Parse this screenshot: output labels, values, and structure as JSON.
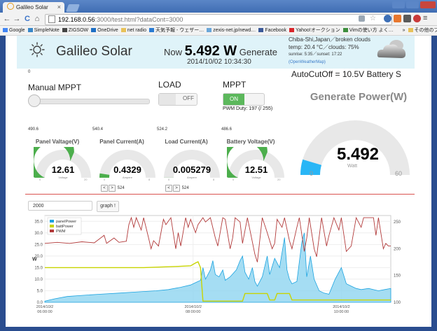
{
  "browser": {
    "tab_title": "Galileo Solar",
    "tab_close": "×",
    "url_host": "192.168.0.56",
    "url_rest": ":3000/test.html?dataCont=3000",
    "nav": {
      "back": "←",
      "forward": "→",
      "reload": "C",
      "home": "⌂"
    },
    "bookmarks": [
      {
        "label": "Google",
        "color": "#4285f4"
      },
      {
        "label": "SimpleNote",
        "color": "#3a87c8"
      },
      {
        "label": "ZIGSOW",
        "color": "#444444"
      },
      {
        "label": "OneDrive",
        "color": "#1e6fc4"
      },
      {
        "label": "net radio",
        "color": "#e8c25a"
      },
      {
        "label": "天気予報 - ウェザー…",
        "color": "#2a7bd3"
      },
      {
        "label": "zexis-net.jp/newd…",
        "color": "#6aa6d8"
      },
      {
        "label": "Facebook",
        "color": "#3b5998"
      },
      {
        "label": "Yahoo!オークション",
        "color": "#d9252a"
      },
      {
        "label": "Vimの使い方 よく…",
        "color": "#3d8e3d"
      },
      {
        "label": "»",
        "color": "#f2f2f2"
      },
      {
        "label": "その他のブックマーク",
        "color": "#e8c25a"
      }
    ]
  },
  "header": {
    "brand": "Galileo Solar",
    "now_prefix": "Now",
    "now_value": "5.492 W",
    "now_suffix": "Generate",
    "timestamp": "2014/10/02 10:34:30",
    "weather_line1": "Chiba-Shi,Japan／broken clouds",
    "weather_line2": "temp: 20.4 °C／clouds: 75%",
    "weather_line3": "sunrise: 5:35／sunset: 17:22",
    "weather_link": "(OpenWeatherMap)"
  },
  "controls": {
    "zero_label": "0",
    "autocutoff": "AutoCutOff = 10.5V Battery S",
    "manual_mppt": "Manual MPPT",
    "load_label": "LOAD",
    "load_state": "OFF",
    "mppt_label": "MPPT",
    "mppt_state": "ON",
    "pwm_duty": "PWM Duty: 197 (/ 255)",
    "slider_level": 0.0
  },
  "gauges": [
    {
      "raw": "490.6",
      "title": "Panel Valtage(V)",
      "value": "12.61",
      "unit": "Voltage",
      "min": "0",
      "max": "20",
      "fraction": 0.63
    },
    {
      "raw": "540.4",
      "title": "Panel Current(A)",
      "value": "0.4329",
      "unit": "Ampere",
      "min": "0",
      "max": "8",
      "fraction": 0.05
    },
    {
      "raw": "524.2",
      "title": "Load Current(A)",
      "value": "0.005279",
      "unit": "Ampere",
      "min": "0",
      "max": "8",
      "fraction": 0.0
    },
    {
      "raw": "486.6",
      "title": "Battery Voltage(V)",
      "value": "12.51",
      "unit": "Voltage",
      "min": "0",
      "max": "20",
      "fraction": 0.63
    }
  ],
  "pagers": [
    {
      "prev": "<",
      "next": ">",
      "value": "524"
    },
    {
      "prev": "<",
      "next": ">",
      "value": "524"
    }
  ],
  "generate_power": {
    "title": "Generate Power(W)",
    "value": "5.492",
    "unit": "Watt",
    "min": "0",
    "max": "60",
    "fraction": 0.0915
  },
  "graph_controls": {
    "input_value": "2000",
    "button_label": "graph !"
  },
  "colors": {
    "green": "#4cae4c",
    "blue": "#29b6f6",
    "track": "#e8e8e8",
    "pvm": "#b23a3a",
    "batt": "#c8d400",
    "panel": "#1ba3e0"
  },
  "chart_data": {
    "type": "line",
    "ylabel": "W",
    "y_ticks": [
      "0.0",
      "5.0",
      "10.0",
      "15.0",
      "20.0",
      "25.0",
      "30.0",
      "35.0"
    ],
    "y2_ticks": [
      "100",
      "150",
      "200",
      "250"
    ],
    "ylim": [
      0,
      37.5
    ],
    "y2lim": [
      100,
      262
    ],
    "x_ticks": [
      [
        "2014/10/2",
        "06:00:00"
      ],
      [
        "2014/10/2",
        "08:00:00"
      ],
      [
        "2014/10/2",
        "10:00:00"
      ]
    ],
    "x_range": [
      "06:00",
      "10:35"
    ],
    "grid": true,
    "legend": "top-left",
    "series": [
      {
        "name": "panelPower",
        "axis": "left",
        "points": [
          [
            0,
            0.5
          ],
          [
            8,
            1.5
          ],
          [
            18,
            2.5
          ],
          [
            30,
            3
          ],
          [
            45,
            3.5
          ],
          [
            60,
            4
          ],
          [
            75,
            4.5
          ],
          [
            90,
            5
          ],
          [
            100,
            5.5
          ],
          [
            110,
            6.5
          ],
          [
            118,
            7.5
          ],
          [
            122,
            8.5
          ],
          [
            126,
            9.5
          ],
          [
            128,
            15
          ],
          [
            130,
            10
          ],
          [
            134,
            14
          ],
          [
            136,
            18
          ],
          [
            138,
            12
          ],
          [
            141,
            11
          ],
          [
            144,
            14
          ],
          [
            146,
            9.5
          ],
          [
            150,
            11
          ],
          [
            155,
            14
          ],
          [
            158,
            18
          ],
          [
            160,
            20
          ],
          [
            162,
            13
          ],
          [
            165,
            10
          ],
          [
            168,
            15
          ],
          [
            170,
            9
          ],
          [
            172,
            7
          ],
          [
            176,
            11
          ],
          [
            180,
            20
          ],
          [
            182,
            12
          ],
          [
            186,
            19
          ],
          [
            190,
            15
          ],
          [
            194,
            28
          ],
          [
            196,
            14
          ],
          [
            198,
            10
          ],
          [
            200,
            8
          ],
          [
            204,
            9
          ],
          [
            208,
            26
          ],
          [
            210,
            30
          ],
          [
            212,
            11
          ],
          [
            215,
            20
          ],
          [
            218,
            10
          ],
          [
            222,
            5
          ],
          [
            226,
            4
          ],
          [
            230,
            3.5
          ],
          [
            235,
            10
          ],
          [
            240,
            15
          ],
          [
            244,
            8
          ],
          [
            248,
            7
          ],
          [
            252,
            6
          ],
          [
            256,
            5.5
          ],
          [
            262,
            6
          ],
          [
            270,
            5
          ],
          [
            275,
            5.5
          ],
          [
            280,
            6
          ]
        ]
      },
      {
        "name": "battPower",
        "axis": "left",
        "points": [
          [
            0,
            15
          ],
          [
            40,
            15
          ],
          [
            80,
            15
          ],
          [
            108,
            15.5
          ],
          [
            118,
            15.8
          ],
          [
            122,
            17
          ],
          [
            124,
            17.5
          ],
          [
            126,
            15
          ],
          [
            128,
            0.5
          ],
          [
            150,
            0.5
          ],
          [
            160,
            0.5
          ],
          [
            162,
            3.8
          ],
          [
            180,
            3.8
          ],
          [
            182,
            1
          ],
          [
            186,
            1
          ],
          [
            188,
            3.8
          ],
          [
            198,
            3.8
          ],
          [
            200,
            1
          ],
          [
            220,
            1
          ],
          [
            240,
            1
          ],
          [
            260,
            1
          ],
          [
            280,
            1
          ]
        ]
      },
      {
        "name": "PWM",
        "axis": "right",
        "points": [
          [
            0,
            210
          ],
          [
            10,
            212
          ],
          [
            20,
            210
          ],
          [
            30,
            213
          ],
          [
            40,
            211
          ],
          [
            48,
            225
          ],
          [
            50,
            210
          ],
          [
            56,
            220
          ],
          [
            60,
            212
          ],
          [
            66,
            214
          ],
          [
            68,
            245
          ],
          [
            70,
            258
          ],
          [
            72,
            240
          ],
          [
            74,
            258
          ],
          [
            78,
            235
          ],
          [
            80,
            258
          ],
          [
            84,
            220
          ],
          [
            86,
            200
          ],
          [
            88,
            215
          ],
          [
            92,
            205
          ],
          [
            96,
            255
          ],
          [
            98,
            245
          ],
          [
            102,
            258
          ],
          [
            106,
            200
          ],
          [
            108,
            230
          ],
          [
            110,
            205
          ],
          [
            114,
            258
          ],
          [
            116,
            240
          ],
          [
            118,
            255
          ],
          [
            122,
            230
          ],
          [
            124,
            245
          ],
          [
            128,
            258
          ],
          [
            130,
            250
          ],
          [
            134,
            258
          ],
          [
            138,
            220
          ],
          [
            140,
            205
          ],
          [
            144,
            258
          ],
          [
            146,
            255
          ],
          [
            150,
            200
          ],
          [
            152,
            220
          ],
          [
            154,
            258
          ],
          [
            158,
            250
          ],
          [
            160,
            210
          ],
          [
            164,
            258
          ],
          [
            166,
            235
          ],
          [
            170,
            190
          ],
          [
            172,
            175
          ],
          [
            176,
            258
          ],
          [
            180,
            230
          ],
          [
            184,
            200
          ],
          [
            186,
            210
          ],
          [
            188,
            255
          ],
          [
            192,
            240
          ],
          [
            194,
            258
          ],
          [
            198,
            215
          ],
          [
            200,
            200
          ],
          [
            204,
            240
          ],
          [
            206,
            258
          ],
          [
            210,
            195
          ],
          [
            212,
            220
          ],
          [
            214,
            258
          ],
          [
            218,
            200
          ],
          [
            220,
            185
          ],
          [
            224,
            258
          ],
          [
            228,
            205
          ],
          [
            230,
            225
          ],
          [
            234,
            258
          ],
          [
            238,
            235
          ],
          [
            240,
            258
          ],
          [
            244,
            195
          ],
          [
            248,
            205
          ],
          [
            252,
            258
          ],
          [
            256,
            240
          ],
          [
            258,
            258
          ],
          [
            262,
            258
          ],
          [
            266,
            258
          ],
          [
            268,
            225
          ],
          [
            270,
            258
          ],
          [
            274,
            200
          ],
          [
            276,
            210
          ],
          [
            278,
            205
          ],
          [
            280,
            205
          ]
        ]
      }
    ]
  }
}
